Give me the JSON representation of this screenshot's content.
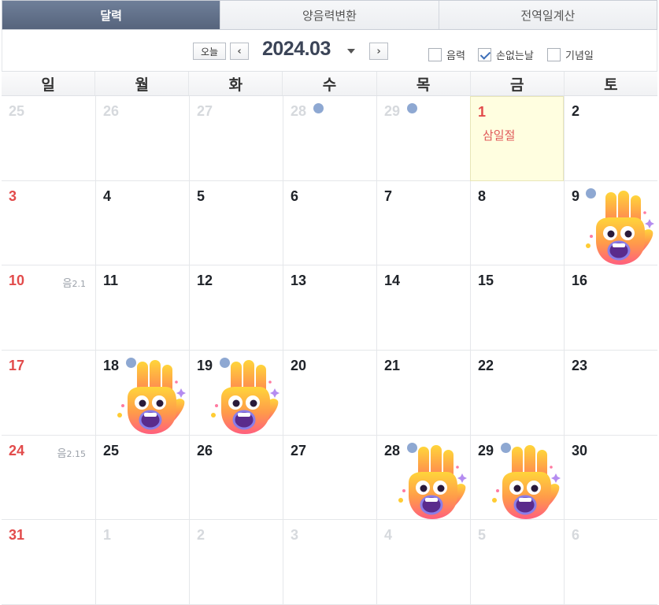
{
  "tabs": [
    {
      "label": "달력",
      "active": true
    },
    {
      "label": "양음력변환",
      "active": false
    },
    {
      "label": "전역일계산",
      "active": false
    }
  ],
  "toolbar": {
    "today_label": "오늘",
    "prev_icon": "‹",
    "next_icon": "›",
    "current_month": "2024.03",
    "options": [
      {
        "label": "음력",
        "checked": false
      },
      {
        "label": "손없는날",
        "checked": true
      },
      {
        "label": "기념일",
        "checked": false
      }
    ]
  },
  "weekdays": [
    "일",
    "월",
    "화",
    "수",
    "목",
    "금",
    "토"
  ],
  "colors": {
    "sunday": "#e24b4b",
    "dot": "#8ea8d2",
    "today_bg": "#fffee0",
    "active_tab": "#5f6e87"
  },
  "weeks": [
    [
      {
        "day": "25",
        "other": true
      },
      {
        "day": "26",
        "other": true
      },
      {
        "day": "27",
        "other": true
      },
      {
        "day": "28",
        "other": true,
        "dot": true
      },
      {
        "day": "29",
        "other": true,
        "dot": true
      },
      {
        "day": "1",
        "holiday": true,
        "highlight": true,
        "label": "삼일절"
      },
      {
        "day": "2"
      }
    ],
    [
      {
        "day": "3"
      },
      {
        "day": "4"
      },
      {
        "day": "5"
      },
      {
        "day": "6"
      },
      {
        "day": "7"
      },
      {
        "day": "8"
      },
      {
        "day": "9",
        "dot": true,
        "hand": true
      }
    ],
    [
      {
        "day": "10",
        "lunar_prefix": "음",
        "lunar_date": "2.1"
      },
      {
        "day": "11"
      },
      {
        "day": "12"
      },
      {
        "day": "13"
      },
      {
        "day": "14"
      },
      {
        "day": "15"
      },
      {
        "day": "16"
      }
    ],
    [
      {
        "day": "17"
      },
      {
        "day": "18",
        "dot": true,
        "hand": true
      },
      {
        "day": "19",
        "dot": true,
        "hand": true
      },
      {
        "day": "20"
      },
      {
        "day": "21"
      },
      {
        "day": "22"
      },
      {
        "day": "23"
      }
    ],
    [
      {
        "day": "24",
        "lunar_prefix": "음",
        "lunar_date": "2.15"
      },
      {
        "day": "25"
      },
      {
        "day": "26"
      },
      {
        "day": "27"
      },
      {
        "day": "28",
        "dot": true,
        "hand": true
      },
      {
        "day": "29",
        "dot": true,
        "hand": true
      },
      {
        "day": "30"
      }
    ],
    [
      {
        "day": "31"
      },
      {
        "day": "1",
        "other": true
      },
      {
        "day": "2",
        "other": true
      },
      {
        "day": "3",
        "other": true
      },
      {
        "day": "4",
        "other": true
      },
      {
        "day": "5",
        "other": true
      },
      {
        "day": "6",
        "other": true
      }
    ]
  ],
  "icons": {
    "hand": "waving-hand-emoji-icon",
    "dot": "no-hands-day-dot-icon"
  }
}
